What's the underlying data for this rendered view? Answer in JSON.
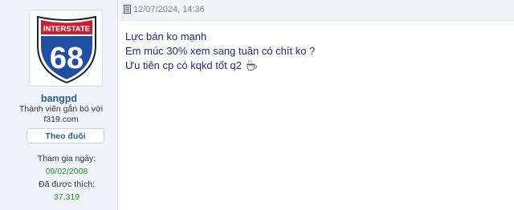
{
  "user": {
    "avatar_icon": "interstate-68-shield-icon",
    "avatar_top_text": "INTERSTATE",
    "avatar_number": "68",
    "username": "bangpd",
    "title_line1": "Thành viên gắn bó với",
    "title_line2": "f319.com",
    "follow_label": "Theo đuôi",
    "join_label": "Tham gia ngày:",
    "join_date": "09/02/2008",
    "likes_label": "Đã được thích:",
    "likes_count": "37.319"
  },
  "post": {
    "date_icon": "document-icon",
    "date": "12/07/2024, 14:36",
    "lines": [
      "Lực bán ko mạnh",
      "Em múc 30% xem sang tuần có chít ko ?",
      "Ưu tiên cp có kqkd tốt q2"
    ],
    "emoji_icon": "coffee-cup-icon"
  },
  "colors": {
    "sidebar_bg": "#f0f3f7",
    "username": "#2b5f8a",
    "stat_value": "#2e8a2e",
    "post_text": "#1c2c7c",
    "shield_blue": "#1f4fa3",
    "shield_red": "#c8202f"
  }
}
